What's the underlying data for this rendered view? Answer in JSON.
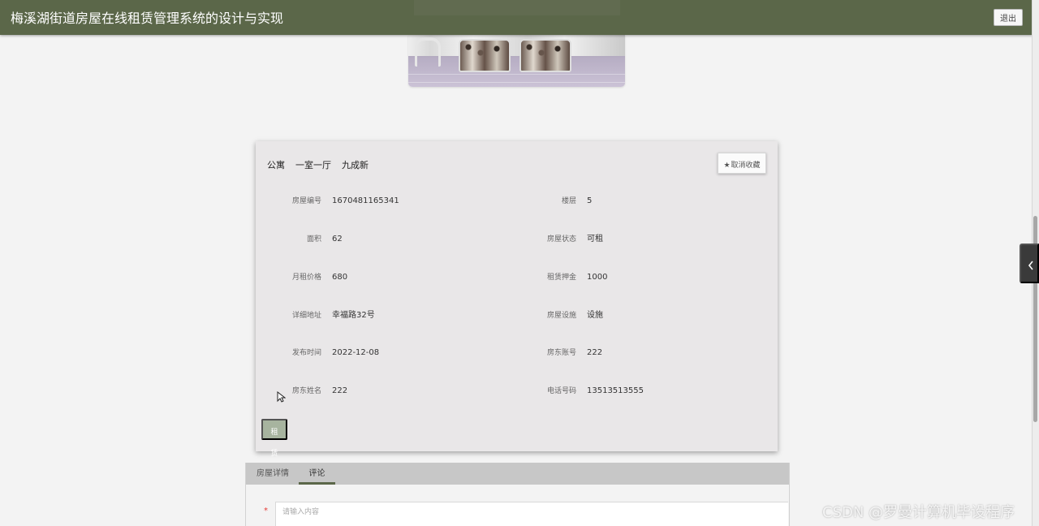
{
  "app": {
    "title": "梅溪湖街道房屋在线租赁管理系统的设计与实现",
    "logout_label": "退出"
  },
  "house": {
    "tags": [
      "公寓",
      "一室一厅",
      "九成新"
    ],
    "favorite_button": "取消收藏",
    "fields_left": [
      {
        "label": "房屋编号",
        "value": "1670481165341"
      },
      {
        "label": "面积",
        "value": "62"
      },
      {
        "label": "月租价格",
        "value": "680"
      },
      {
        "label": "详细地址",
        "value": "幸福路32号"
      },
      {
        "label": "发布时间",
        "value": "2022-12-08"
      },
      {
        "label": "房东姓名",
        "value": "222"
      }
    ],
    "fields_right": [
      {
        "label": "楼层",
        "value": "5"
      },
      {
        "label": "房屋状态",
        "value": "可租"
      },
      {
        "label": "租赁押金",
        "value": "1000"
      },
      {
        "label": "房屋设施",
        "value": "设施"
      },
      {
        "label": "房东账号",
        "value": "222"
      },
      {
        "label": "电话号码",
        "value": "13513513555"
      }
    ],
    "rent_button": "租赁"
  },
  "details": {
    "tabs": [
      "房屋详情",
      "评论"
    ],
    "active_tab": "评论",
    "comment_placeholder": "请输入内容",
    "required_marker": "*"
  },
  "icons": {
    "favorite": "star-icon",
    "side_toggle": "chevron-left-icon",
    "cursor": "mouse-cursor-icon"
  },
  "colors": {
    "header": "#5b6749",
    "active_tab_line": "#5b6749",
    "rent_button": "#a7b49f"
  },
  "watermark": "CSDN @罗曼计算机毕设程序"
}
